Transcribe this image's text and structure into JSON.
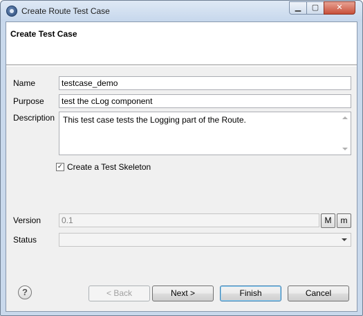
{
  "window": {
    "title": "Create Route Test Case",
    "minimize_glyph": "▁",
    "maximize_glyph": "▢",
    "close_glyph": "✕"
  },
  "header": {
    "title": "Create Test Case"
  },
  "form": {
    "name_label": "Name",
    "name_value": "testcase_demo",
    "purpose_label": "Purpose",
    "purpose_value": "test the cLog component",
    "description_label": "Description",
    "description_value": "This test case tests the Logging part of the Route.",
    "skeleton_label": "Create a Test Skeleton",
    "skeleton_checked": true,
    "version_label": "Version",
    "version_value": "0.1",
    "major_label": "M",
    "minor_label": "m",
    "status_label": "Status",
    "status_value": ""
  },
  "buttons": {
    "help": "?",
    "back": "< Back",
    "next": "Next >",
    "finish": "Finish",
    "cancel": "Cancel"
  }
}
